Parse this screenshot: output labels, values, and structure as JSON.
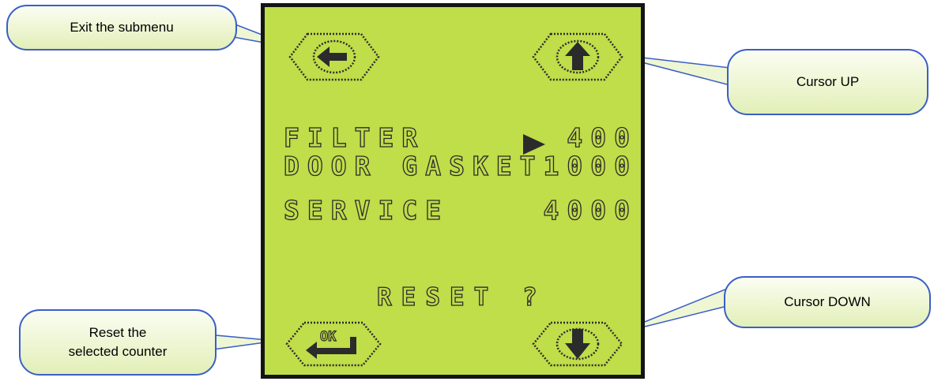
{
  "callouts": {
    "exit": "Exit the submenu",
    "up": "Cursor UP",
    "reset_line1": "Reset the",
    "reset_line2": "selected counter",
    "down": "Cursor DOWN"
  },
  "lcd": {
    "rows": [
      {
        "label": "FILTER",
        "value": "400",
        "selected": true
      },
      {
        "label": "DOOR GASKET",
        "value": "1000",
        "selected": false
      },
      {
        "label": "SERVICE",
        "value": "4000",
        "selected": false
      }
    ],
    "prompt": "RESET ?",
    "ok_label": "OK"
  },
  "icons": {
    "back": "arrow-left-icon",
    "up": "arrow-up-icon",
    "ok": "ok-enter-icon",
    "down": "arrow-down-icon"
  },
  "colors": {
    "lcd_background": "#c0dd4a",
    "lcd_pixel": "#2b2b2b",
    "callout_border": "#3a5fc6"
  }
}
